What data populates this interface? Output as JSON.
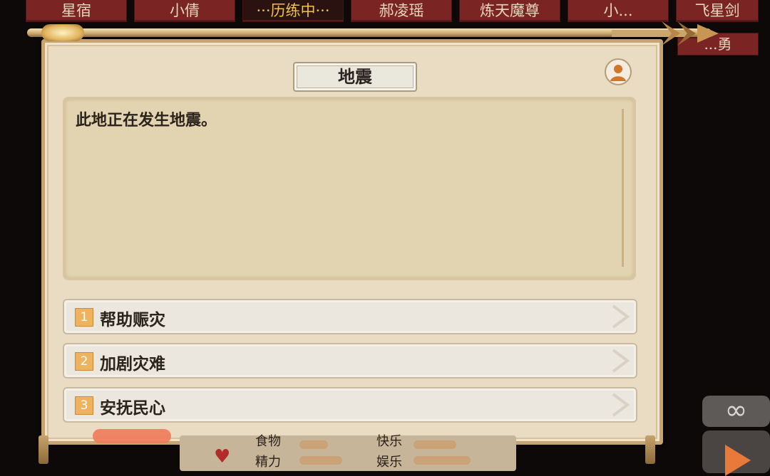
{
  "tabs": [
    {
      "label": "星宿"
    },
    {
      "label": "小倩"
    },
    {
      "label": "···历练中···"
    },
    {
      "label": "郝凌瑶"
    },
    {
      "label": "炼天魔尊"
    },
    {
      "label": "小..."
    },
    {
      "label": "飞星剑"
    }
  ],
  "tab_row2": "...勇",
  "event": {
    "title": "地震",
    "description": "此地正在发生地震。"
  },
  "options": [
    {
      "num": "1",
      "label": "帮助赈灾"
    },
    {
      "num": "2",
      "label": "加剧灾难"
    },
    {
      "num": "3",
      "label": "安抚民心"
    }
  ],
  "stats": {
    "food": "食物",
    "joy_top": "快乐",
    "energy": "精力",
    "entertainment": "娱乐"
  },
  "controls": {
    "infinity": "∞"
  },
  "colors": {
    "tab_bg": "#7a2424",
    "tab_active_text": "#f0c24a",
    "panel_bg": "#e9dcc3",
    "option_num": "#efb25e",
    "play_arrow": "#e8793a"
  },
  "icons": {
    "avatar": "avatar-icon",
    "heart": "heart-icon",
    "play": "play-icon"
  }
}
